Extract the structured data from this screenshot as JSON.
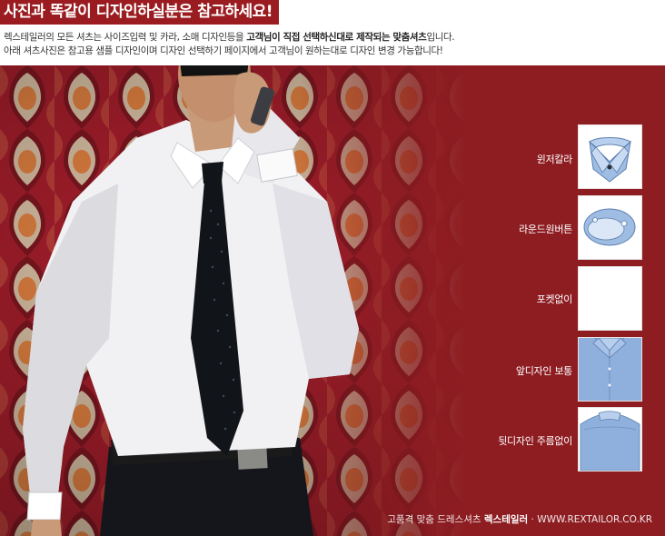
{
  "header": {
    "banner": "사진과 똑같이 디자인하실분은 참고하세요!",
    "line1_a": "렉스테일러의 모든 셔츠는 사이즈입력 및 카라, 소매 디자인등을 ",
    "line1_b": "고객님이 직접 선택하신대로 제작되는 맞춤셔츠",
    "line1_c": "입니다.",
    "line2": "아래 셔츠사진은 참고용 샘플 디자인이며 디자인 선택하기 페이지에서 고객님이 원하는대로 디자인 변경 가능합니다!"
  },
  "options": [
    {
      "label": "윈저칼라",
      "icon": "windsor-collar-thumbnail"
    },
    {
      "label": "라운드원버튼",
      "icon": "round-one-button-cuff-thumbnail"
    },
    {
      "label": "포켓없이",
      "icon": "no-pocket-thumbnail"
    },
    {
      "label": "앞디자인 보통",
      "icon": "front-design-normal-thumbnail"
    },
    {
      "label": "뒷디자인 주름없이",
      "icon": "back-design-no-pleat-thumbnail"
    }
  ],
  "footer": {
    "prefix": "고품격 맞춤 드레스셔츠 ",
    "brand": "렉스테일러",
    "suffix": " · WWW.REXTAILOR.CO.KR"
  },
  "colors": {
    "banner": "#9b1c20",
    "background": "#8e1d22",
    "shirt_blue": "#8fb0dc",
    "tie": "#111418"
  }
}
